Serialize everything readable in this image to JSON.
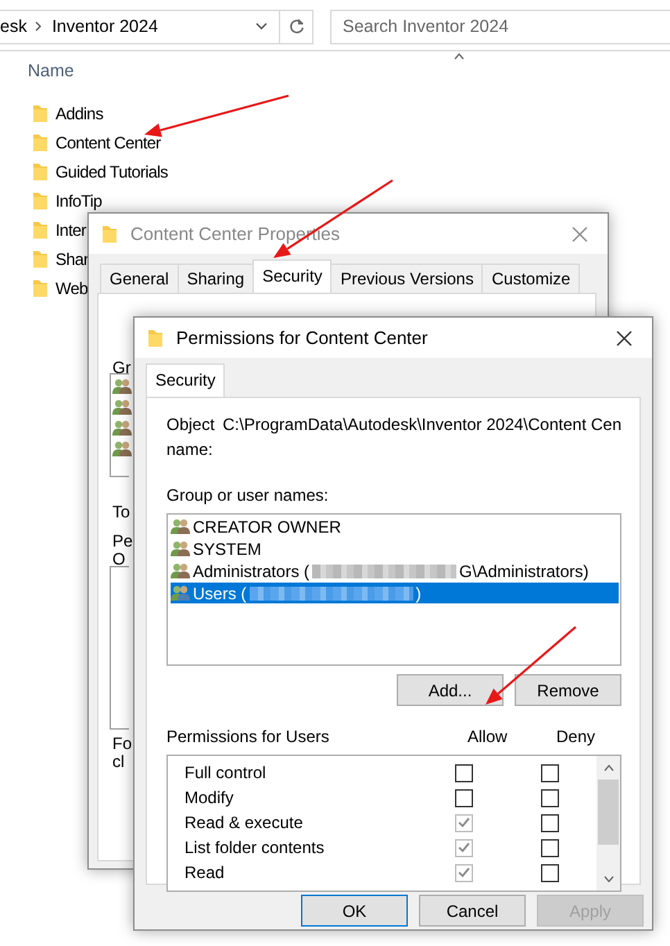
{
  "explorer": {
    "breadcrumb": [
      "esk",
      "Inventor 2024"
    ],
    "search": {
      "placeholder": "Search Inventor 2024"
    },
    "column": "Name",
    "folders": [
      {
        "name": "Addins"
      },
      {
        "name": "Content Center"
      },
      {
        "name": "Guided Tutorials"
      },
      {
        "name": "InfoTip"
      },
      {
        "name": "Inter"
      },
      {
        "name": "Shar"
      },
      {
        "name": "Web"
      }
    ]
  },
  "properties_dialog": {
    "title": "Content Center Properties",
    "tabs": [
      {
        "label": "General",
        "selected": false
      },
      {
        "label": "Sharing",
        "selected": false
      },
      {
        "label": "Security",
        "selected": true
      },
      {
        "label": "Previous Versions",
        "selected": false
      },
      {
        "label": "Customize",
        "selected": false
      }
    ],
    "label_fragments": [
      "Gr",
      "To",
      "Pe",
      "O",
      "Fo",
      "cl"
    ]
  },
  "permissions_dialog": {
    "title": "Permissions for Content Center",
    "tabs": [
      {
        "label": "Security",
        "selected": true
      }
    ],
    "object_name_label": "Object name:",
    "object_name": "C:\\ProgramData\\Autodesk\\Inventor 2024\\Content Cen",
    "group_label": "Group or user names:",
    "users": [
      {
        "name": "CREATOR OWNER",
        "selected": false,
        "redacted": false
      },
      {
        "name": "SYSTEM",
        "selected": false,
        "redacted": false
      },
      {
        "name": "Administrators (",
        "suffix": "G\\Administrators)",
        "selected": false,
        "redacted": true
      },
      {
        "name": "Users (",
        "suffix": ")",
        "selected": true,
        "redacted": true
      }
    ],
    "user_buttons": [
      "Add...",
      "Remove"
    ],
    "permissions_label": "Permissions for Users",
    "allow_header": "Allow",
    "deny_header": "Deny",
    "permissions": [
      {
        "name": "Full control",
        "allow": false,
        "allow_disabled": false,
        "deny": false
      },
      {
        "name": "Modify",
        "allow": false,
        "allow_disabled": false,
        "deny": false
      },
      {
        "name": "Read & execute",
        "allow": true,
        "allow_disabled": true,
        "deny": false
      },
      {
        "name": "List folder contents",
        "allow": true,
        "allow_disabled": true,
        "deny": false
      },
      {
        "name": "Read",
        "allow": true,
        "allow_disabled": true,
        "deny": false
      }
    ],
    "dialog_buttons": [
      {
        "label": "OK",
        "disabled": false,
        "default": true
      },
      {
        "label": "Cancel",
        "disabled": false,
        "default": false
      },
      {
        "label": "Apply",
        "disabled": true,
        "default": false
      }
    ]
  }
}
